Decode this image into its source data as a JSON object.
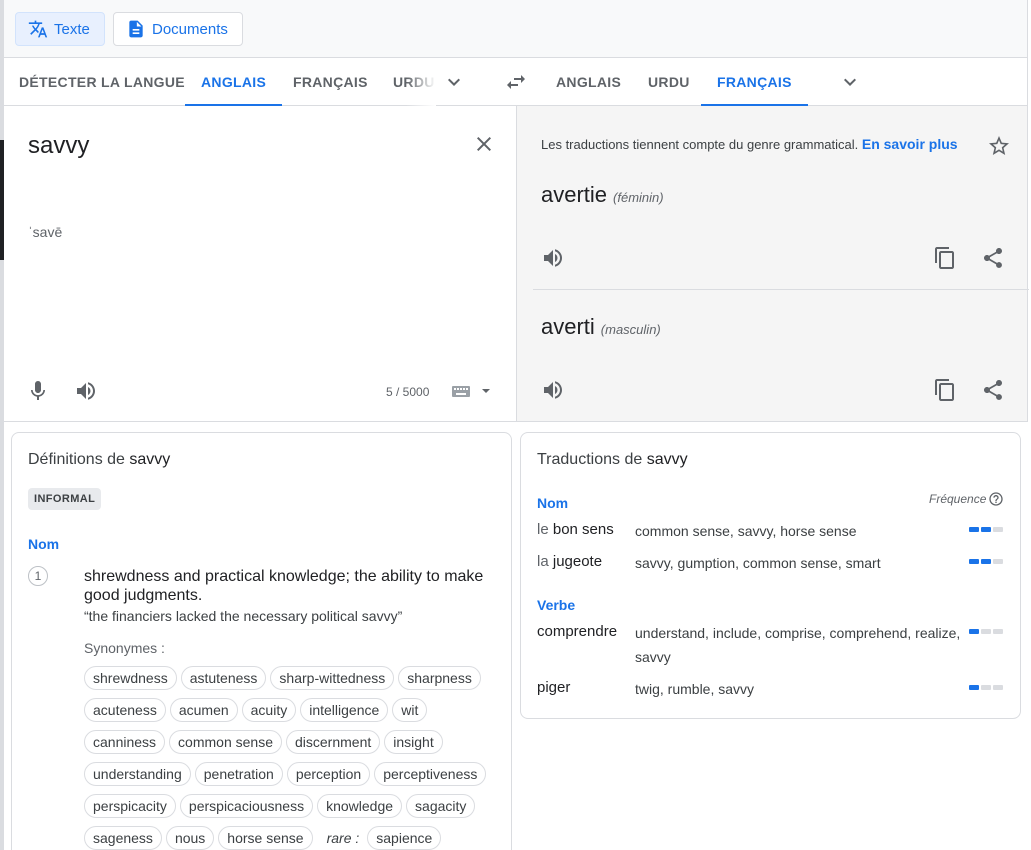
{
  "modes": [
    {
      "label": "Texte",
      "icon": "translate-icon",
      "active": true
    },
    {
      "label": "Documents",
      "icon": "document-icon",
      "active": false
    }
  ],
  "source_langs": [
    "DÉTECTER LA LANGUE",
    "ANGLAIS",
    "FRANÇAIS",
    "URDU"
  ],
  "source_active": 1,
  "target_langs": [
    "ANGLAIS",
    "URDU",
    "FRANÇAIS"
  ],
  "target_active": 2,
  "source": {
    "text": "savvy",
    "transliteration": "ˈsavē",
    "char_count": "5 / 5000"
  },
  "target": {
    "gender_note": "Les traductions tiennent compte du genre grammatical.",
    "learn_more": "En savoir plus",
    "translations": [
      {
        "word": "avertie",
        "gender": "(féminin)"
      },
      {
        "word": "averti",
        "gender": "(masculin)"
      }
    ]
  },
  "definitions": {
    "title_prefix": "Définitions de",
    "word": "savvy",
    "tag": "INFORMAL",
    "pos": "Nom",
    "number": "1",
    "definition_line1": "shrewdness and practical knowledge; the ability to make",
    "definition_line2": "good judgments.",
    "example": "“the financiers lacked the necessary political savvy”",
    "synonyms_label": "Synonymes :",
    "synonyms": [
      "shrewdness",
      "astuteness",
      "sharp-wittedness",
      "sharpness",
      "acuteness",
      "acumen",
      "acuity",
      "intelligence",
      "wit",
      "canniness",
      "common sense",
      "discernment",
      "insight",
      "understanding",
      "penetration",
      "perception",
      "perceptiveness",
      "perspicacity",
      "perspicaciousness",
      "knowledge",
      "sagacity",
      "sageness",
      "nous",
      "horse sense"
    ],
    "rare_label": "rare :",
    "rare_synonyms": [
      "sapience"
    ]
  },
  "translations_card": {
    "title_prefix": "Traductions de",
    "word": "savvy",
    "frequency_label": "Fréquence",
    "groups": [
      {
        "pos": "Nom",
        "rows": [
          {
            "article": "le",
            "term": "bon sens",
            "synonyms": "common sense, savvy, horse sense",
            "frequency": 2
          },
          {
            "article": "la",
            "term": "jugeote",
            "synonyms": "savvy, gumption, common sense, smart",
            "frequency": 2
          }
        ]
      },
      {
        "pos": "Verbe",
        "rows": [
          {
            "article": "",
            "term": "comprendre",
            "synonyms": "understand, include, comprise, comprehend, realize, savvy",
            "frequency": 1
          },
          {
            "article": "",
            "term": "piger",
            "synonyms": "twig, rumble, savvy",
            "frequency": 1
          }
        ]
      }
    ]
  }
}
